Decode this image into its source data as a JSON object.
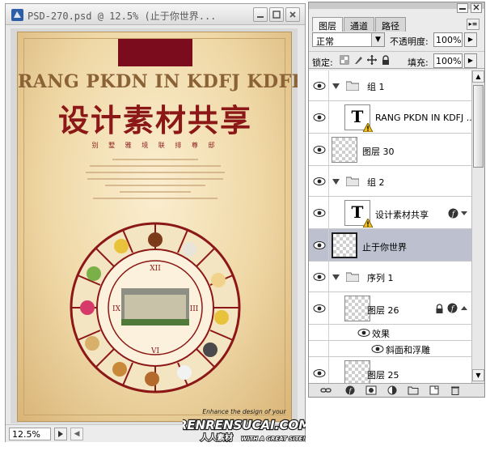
{
  "document": {
    "title": "PSD-270.psd @ 12.5% (止于你世界...",
    "zoom": "12.5%",
    "buttons": [
      "minimize-icon",
      "maximize-icon",
      "close-icon"
    ],
    "poster": {
      "heading": "RANG PKDN IN KDFJ  KDFKD",
      "title_cn": "设计素材共享",
      "subtitle": "别 墅 雅 境   联 排 尊 邸",
      "colors": {
        "bar": "#7b0c1d",
        "title": "#8b1717",
        "heading": "#8a6236"
      }
    }
  },
  "layers_panel": {
    "tabs": [
      "图层",
      "通道",
      "路径"
    ],
    "active_tab": 0,
    "blend_mode": "正常",
    "opacity_label": "不透明度:",
    "opacity": "100%",
    "lock_label": "锁定:",
    "fill_label": "填充:",
    "fill": "100%",
    "layers": [
      {
        "type": "group",
        "name": "组 1",
        "expanded": true
      },
      {
        "type": "text",
        "name": "RANG PKDN IN KDFJ ...",
        "warning": true
      },
      {
        "type": "pixel",
        "name": "图层 30"
      },
      {
        "type": "group",
        "name": "组 2",
        "expanded": true
      },
      {
        "type": "text",
        "name": "设计素材共享",
        "warning": true,
        "fx": true
      },
      {
        "type": "pixel",
        "name": "止于你世界",
        "selected": true
      },
      {
        "type": "group",
        "name": "序列 1",
        "expanded": true
      },
      {
        "type": "pixel",
        "name": "图层 26",
        "locked": true,
        "fx": true
      },
      {
        "type": "effects",
        "name": "效果"
      },
      {
        "type": "effect",
        "name": "斜面和浮雕"
      },
      {
        "type": "pixel",
        "name": "图层 25"
      }
    ],
    "bottom_icons": [
      "link-icon",
      "fx-icon",
      "mask-icon",
      "adjustment-icon",
      "new-group-icon",
      "new-layer-icon",
      "trash-icon"
    ]
  },
  "watermark": {
    "line1": "Enhance the design of your",
    "brand": "RENRENSUCAI.COM",
    "line2": "人人素材",
    "line3": "WITH A GREAT SITE!"
  }
}
